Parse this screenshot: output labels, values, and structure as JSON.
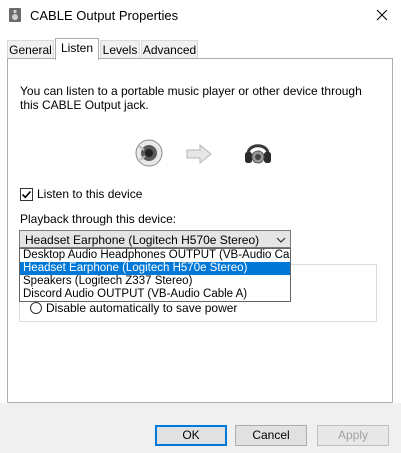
{
  "window": {
    "title": "CABLE Output Properties"
  },
  "tabs": [
    {
      "label": "General"
    },
    {
      "label": "Listen"
    },
    {
      "label": "Levels"
    },
    {
      "label": "Advanced"
    }
  ],
  "listen": {
    "description": "You can listen to a portable music player or other device through this CABLE Output jack.",
    "listen_checkbox": {
      "label": "Listen to this device",
      "checked": true
    },
    "playback_label": "Playback through this device:",
    "playback_selected": "Headset Earphone (Logitech H570e Stereo)",
    "dropdown_options": [
      "Desktop Audio Headphones OUTPUT (VB-Audio Cab",
      "Headset Earphone (Logitech H570e Stereo)",
      "Speakers (Logitech Z337 Stereo)",
      "Discord Audio OUTPUT (VB-Audio Cable A)"
    ],
    "highlighted_option_index": 1,
    "power_radio_label": "Disable automatically to save power"
  },
  "buttons": {
    "ok": "OK",
    "cancel": "Cancel",
    "apply": "Apply"
  },
  "icons": {
    "title": "speaker-icon",
    "close": "close-icon",
    "source_device": "audio-jack-icon",
    "arrow": "arrow-right-icon",
    "target_device": "headset-icon",
    "combo_arrow": "chevron-down-icon"
  },
  "colors": {
    "accent": "#0078d7"
  }
}
